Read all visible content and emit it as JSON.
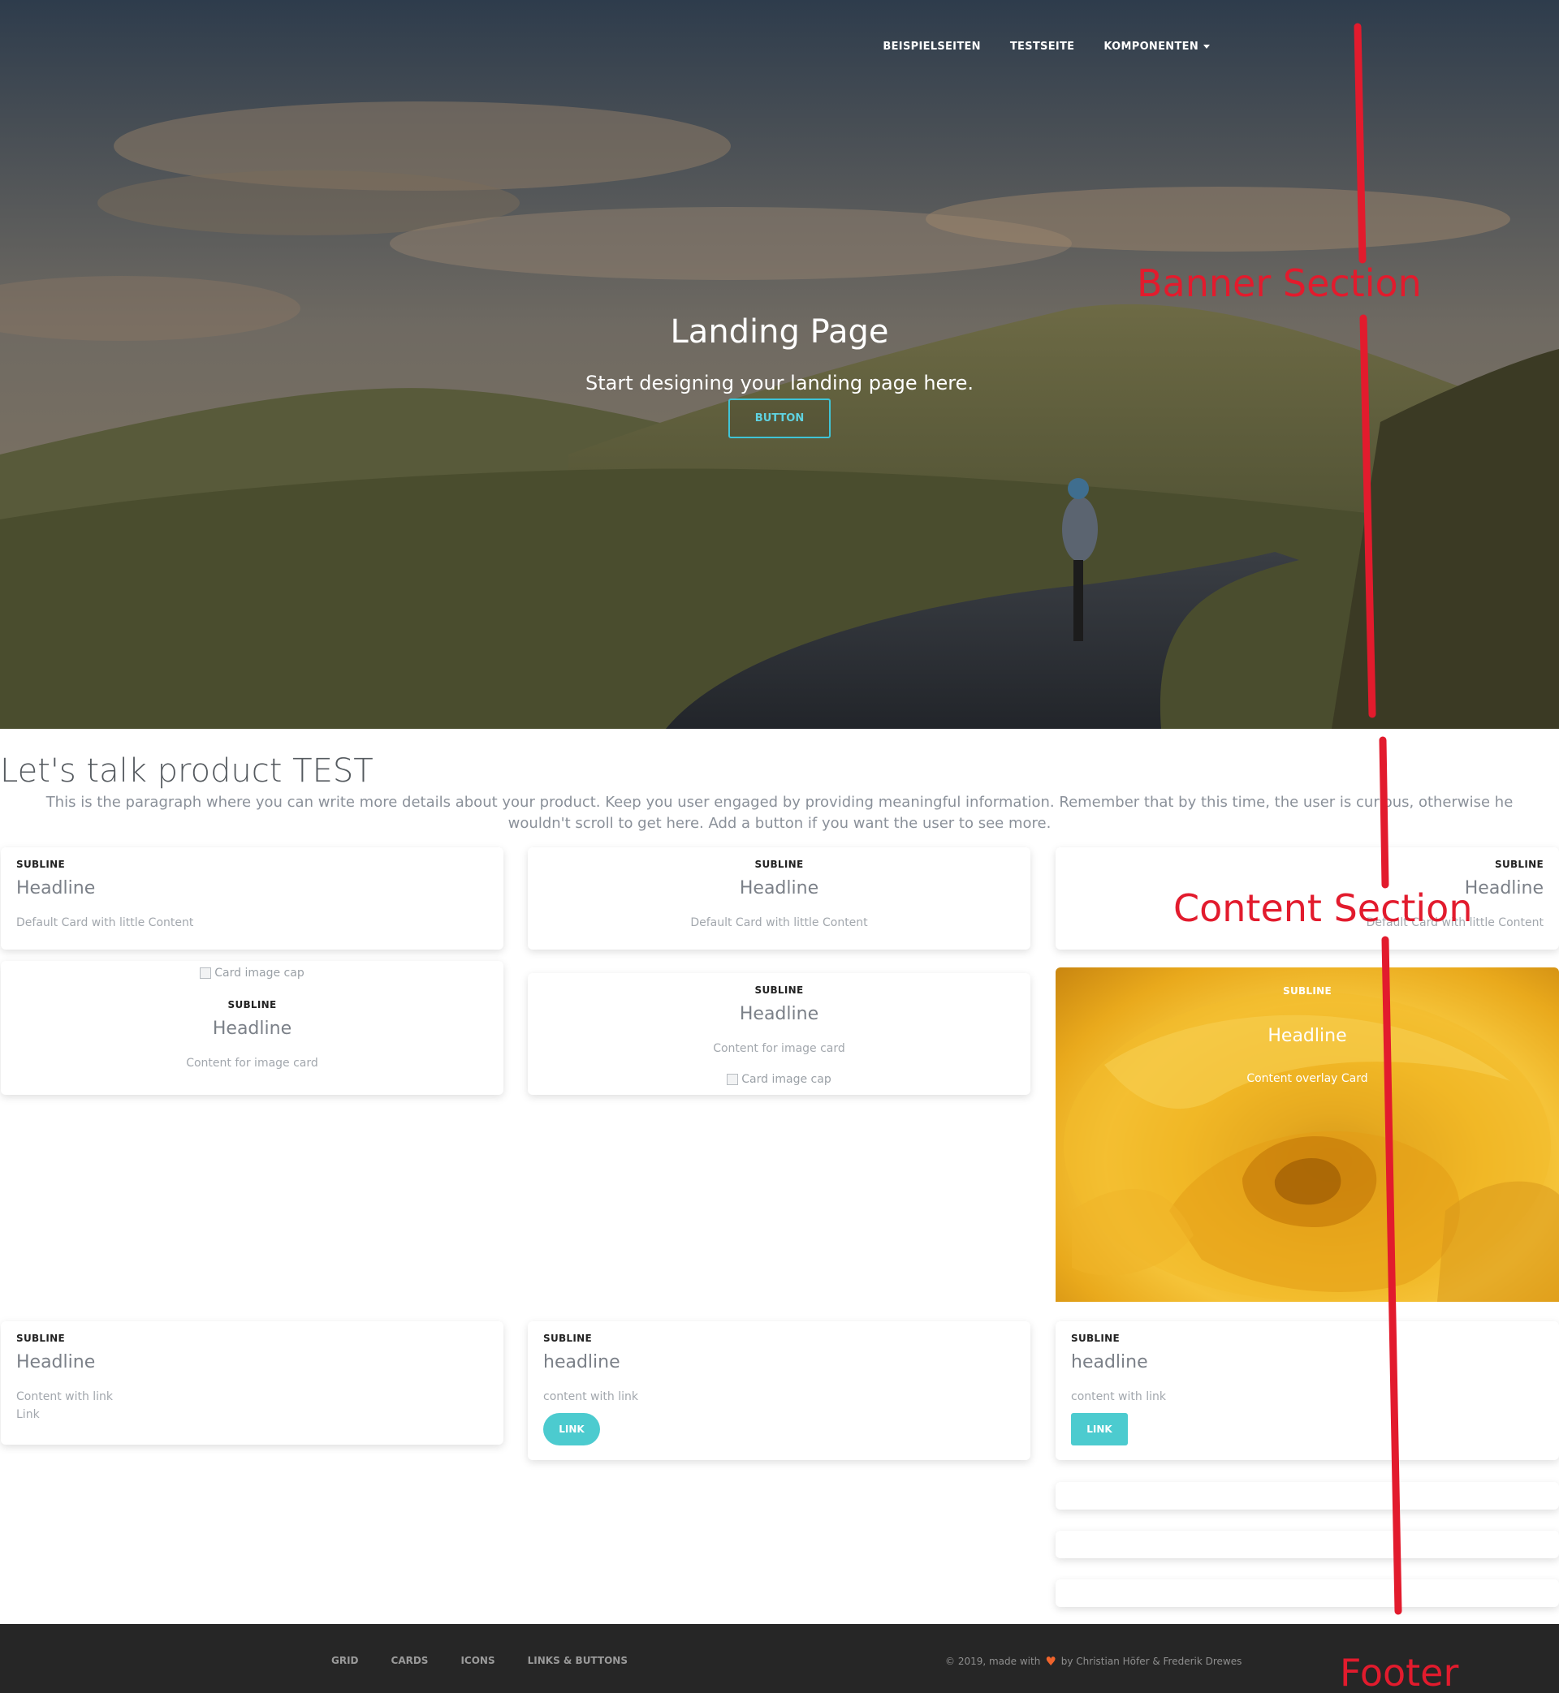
{
  "nav": {
    "items": [
      {
        "label": "BEISPIELSEITEN"
      },
      {
        "label": "TESTSEITE"
      },
      {
        "label": "KOMPONENTEN"
      }
    ]
  },
  "hero": {
    "title": "Landing Page",
    "subtitle": "Start designing your landing page here.",
    "button_label": "BUTTON"
  },
  "content": {
    "title": "Let's talk product TEST",
    "paragraph": "This is the paragraph where you can write more details about your product. Keep you user engaged by providing meaningful information. Remember that by this time, the user is curious, otherwise he wouldn't scroll to get here. Add a button if you want the user to see more.",
    "cards": {
      "c1": {
        "subline": "SUBLINE",
        "headline": "Headline",
        "text": "Default Card with little Content"
      },
      "c2": {
        "subline": "SUBLINE",
        "headline": "Headline",
        "text": "Default Card with little Content"
      },
      "c3": {
        "subline": "SUBLINE",
        "headline": "Headline",
        "text": "Default Card with little Content"
      },
      "c4": {
        "image_alt": "Card image cap",
        "subline": "SUBLINE",
        "headline": "Headline",
        "text": "Content for image card"
      },
      "c5": {
        "subline": "SUBLINE",
        "headline": "Headline",
        "text": "Content for image card",
        "image_alt": "Card image cap"
      },
      "c6": {
        "subline": "SUBLINE",
        "headline": "Headline",
        "text": "Content overlay Card"
      },
      "c7": {
        "subline": "SUBLINE",
        "headline": "Headline",
        "text": "Content with link",
        "link": "Link"
      },
      "c8": {
        "subline": "SUBLINE",
        "headline": "headline",
        "text": "content with link",
        "button": "LINK"
      },
      "c9": {
        "subline": "SUBLINE",
        "headline": "headline",
        "text": "content with link",
        "button": "LINK"
      }
    }
  },
  "footer": {
    "links": [
      "GRID",
      "CARDS",
      "ICONS",
      "LINKS & BUTTONS"
    ],
    "credit_prefix": "© 2019, made with",
    "heart_icon": "heart-icon",
    "credit_suffix": "by Christian Höfer & Frederik Drewes"
  },
  "annotations": {
    "banner": "Banner Section",
    "content": "Content Section",
    "footer": "Footer"
  },
  "colors": {
    "accent": "#4ccbcf",
    "hero_button_border": "#3fc4d6",
    "footer_bg": "#262626",
    "annotation": "#e21b2d",
    "heart": "#f0642c"
  }
}
